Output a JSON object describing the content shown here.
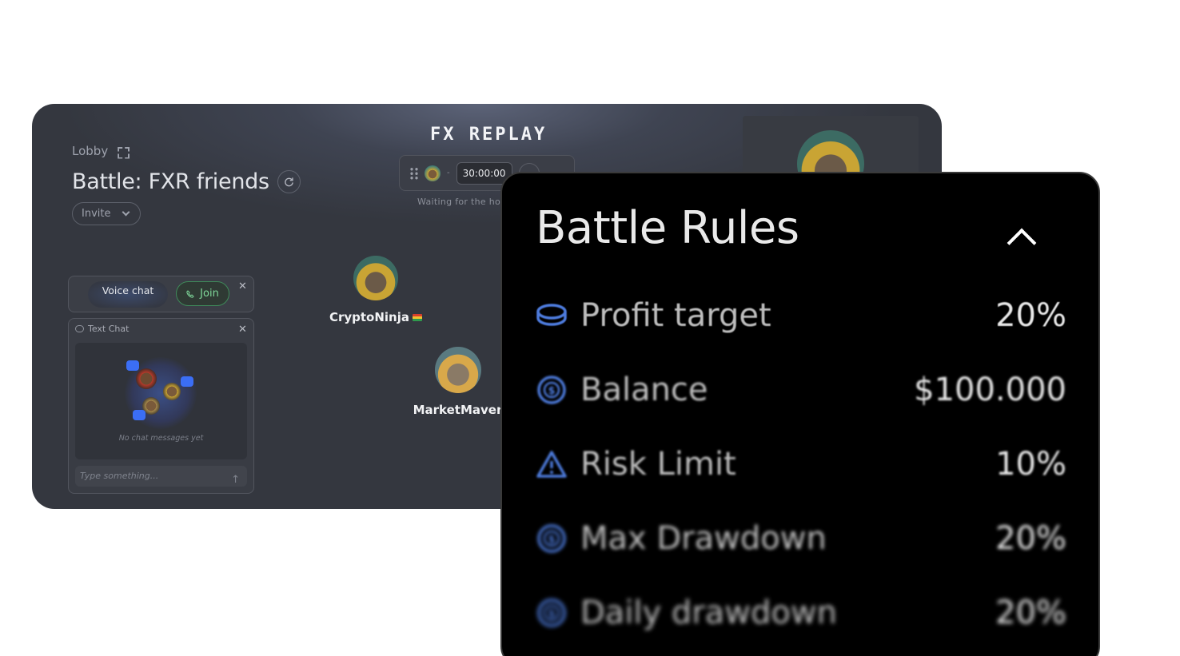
{
  "lobby": {
    "breadcrumb": "Lobby",
    "title": "Battle: FXR friends",
    "invite_label": "Invite",
    "logo_text": "FX REPLAY",
    "timer": "30:00:00",
    "waiting_text": "Waiting for the hos"
  },
  "voice_chat": {
    "label": "Voice chat",
    "join_label": "Join"
  },
  "text_chat": {
    "title": "Text Chat",
    "empty_text": "No chat messages yet",
    "input_placeholder": "Type something..."
  },
  "players": [
    {
      "name": "CryptoNinja"
    },
    {
      "name": "MarketMaver"
    }
  ],
  "battle_rules": {
    "title": "Battle Rules",
    "rules": [
      {
        "label": "Profit target",
        "value": "20%",
        "icon": "coin-stack-icon"
      },
      {
        "label": "Balance",
        "value": "$100.000",
        "icon": "dollar-coin-icon"
      },
      {
        "label": "Risk Limit",
        "value": "10%",
        "icon": "warning-triangle-icon"
      },
      {
        "label": "Max Drawdown",
        "value": "20%",
        "icon": "dollar-coin-icon"
      },
      {
        "label": "Daily drawdown",
        "value": "20%",
        "icon": "dollar-coin-icon"
      }
    ]
  },
  "colors": {
    "accent_blue": "#3b6ef5",
    "join_green": "#7fd79a",
    "rules_bg": "#000000",
    "icon_blue": "#4d7bdc"
  }
}
